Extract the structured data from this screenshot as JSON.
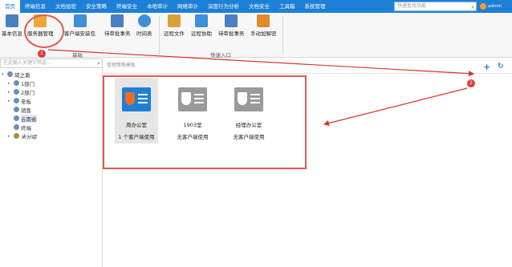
{
  "menu": {
    "items": [
      "首页",
      "终端信息",
      "文档加密",
      "安全策略",
      "终端安全",
      "本地审计",
      "网络审计",
      "深度行为分析",
      "文档安全",
      "工具箱",
      "系统管理"
    ],
    "search_placeholder": "快速查找功能",
    "user": "admin"
  },
  "ribbon": {
    "tools": [
      "基本信息",
      "服务器管理",
      "客户端安装包",
      "待审批事务",
      "时间表",
      "远程文件",
      "远程协助",
      "待审批事务",
      "手动加解密"
    ],
    "group1": "基础",
    "group2": "快速入口"
  },
  "badges": {
    "one": "1",
    "two": "2"
  },
  "tree": {
    "search_placeholder": "在此输入关键字筛选...",
    "root": "域之盾",
    "nodes": [
      "1部门",
      "2部门",
      "老板",
      "销售",
      "云南省",
      "终端",
      "未分组"
    ]
  },
  "pane": {
    "title": "管理策略模板",
    "cards": [
      {
        "name": "周办公室",
        "sub": "1 个客户端使用"
      },
      {
        "name": "1903室",
        "sub": "无客户端使用"
      },
      {
        "name": "经理办公室",
        "sub": "无客户端使用"
      }
    ]
  },
  "colors": {
    "accent": "#1e7fd6",
    "highlight": "#e05a4f",
    "card_active": "#1e7fd6",
    "card_inactive": "#9a9a9a"
  }
}
